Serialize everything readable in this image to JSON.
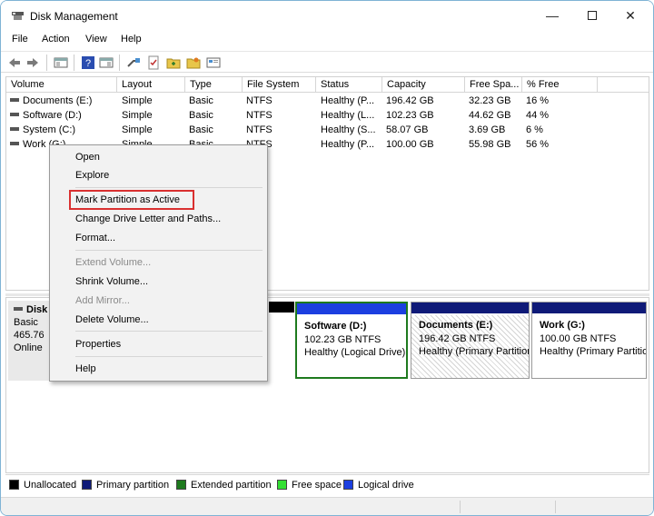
{
  "window": {
    "title": "Disk Management",
    "icon": "disk-management-icon",
    "controls": {
      "minimize": "—",
      "maximize": "maximize-icon",
      "close": "✕"
    }
  },
  "menu": [
    "File",
    "Action",
    "View",
    "Help"
  ],
  "toolbar_icons": [
    "back-arrow-icon",
    "forward-arrow-icon",
    "console-tree-icon",
    "help-icon",
    "show-hide-icon",
    "connect-icon",
    "checklist-icon",
    "folder-icon",
    "folder-star-icon",
    "window-icon"
  ],
  "volume_table": {
    "columns": [
      "Volume",
      "Layout",
      "Type",
      "File System",
      "Status",
      "Capacity",
      "Free Spa...",
      "% Free"
    ],
    "rows": [
      {
        "volume": "Documents (E:)",
        "layout": "Simple",
        "type": "Basic",
        "fs": "NTFS",
        "status": "Healthy (P...",
        "capacity": "196.42 GB",
        "free": "32.23 GB",
        "pct": "16 %"
      },
      {
        "volume": "Software (D:)",
        "layout": "Simple",
        "type": "Basic",
        "fs": "NTFS",
        "status": "Healthy (L...",
        "capacity": "102.23 GB",
        "free": "44.62 GB",
        "pct": "44 %"
      },
      {
        "volume": "System (C:)",
        "layout": "Simple",
        "type": "Basic",
        "fs": "NTFS",
        "status": "Healthy (S...",
        "capacity": "58.07 GB",
        "free": "3.69 GB",
        "pct": "6 %"
      },
      {
        "volume": "Work (G:)",
        "layout": "Simple",
        "type": "Basic",
        "fs": "NTFS",
        "status": "Healthy (P...",
        "capacity": "100.00 GB",
        "free": "55.98 GB",
        "pct": "56 %"
      }
    ]
  },
  "disk": {
    "title": "Disk",
    "type": "Basic",
    "size": "465.76",
    "state": "Online"
  },
  "partitions": [
    {
      "name": "Software  (D:)",
      "size": "102.23 GB NTFS",
      "status": "Healthy (Logical Drive)",
      "bar_color": "#1c3fe0",
      "selected": true,
      "hatched": false
    },
    {
      "name": "Documents  (E:)",
      "size": "196.42 GB NTFS",
      "status": "Healthy (Primary Partition)",
      "bar_color": "#0f1a78",
      "selected": false,
      "hatched": true
    },
    {
      "name": "Work  (G:)",
      "size": "100.00 GB NTFS",
      "status": "Healthy (Primary Partition)",
      "bar_color": "#0f1a78",
      "selected": false,
      "hatched": false
    }
  ],
  "legend": [
    {
      "label": "Unallocated",
      "color": "#000000"
    },
    {
      "label": "Primary partition",
      "color": "#0f1a78"
    },
    {
      "label": "Extended partition",
      "color": "#1e7a1e"
    },
    {
      "label": "Free space",
      "color": "#33e033"
    },
    {
      "label": "Logical drive",
      "color": "#1c3fe0"
    }
  ],
  "context_menu": {
    "items": [
      {
        "label": "Open",
        "enabled": true
      },
      {
        "label": "Explore",
        "enabled": true
      },
      {
        "label": "Mark Partition as Active",
        "enabled": true,
        "highlighted": true
      },
      {
        "label": "Change Drive Letter and Paths...",
        "enabled": true
      },
      {
        "label": "Format...",
        "enabled": true
      },
      {
        "label": "Extend Volume...",
        "enabled": false
      },
      {
        "label": "Shrink Volume...",
        "enabled": true
      },
      {
        "label": "Add Mirror...",
        "enabled": false
      },
      {
        "label": "Delete Volume...",
        "enabled": true
      },
      {
        "label": "Properties",
        "enabled": true
      },
      {
        "label": "Help",
        "enabled": true
      }
    ]
  }
}
